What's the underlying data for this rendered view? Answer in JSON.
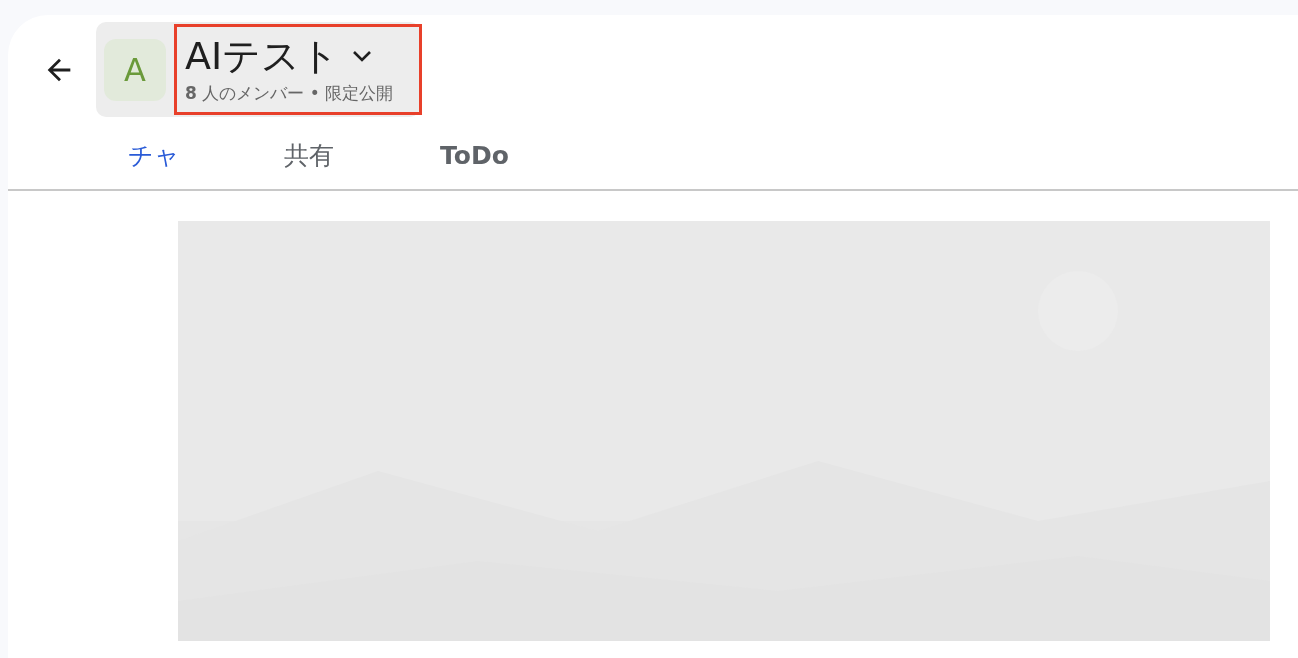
{
  "header": {
    "avatar_letter": "A",
    "title": "AIテスト",
    "member_count": "8",
    "member_label": "人のメンバー",
    "separator": "•",
    "visibility": "限定公開",
    "highlighted": true
  },
  "tabs": [
    {
      "label": "チャ",
      "selected": true
    },
    {
      "label": "共有",
      "selected": false
    },
    {
      "label": "ToDo",
      "selected": false
    }
  ]
}
